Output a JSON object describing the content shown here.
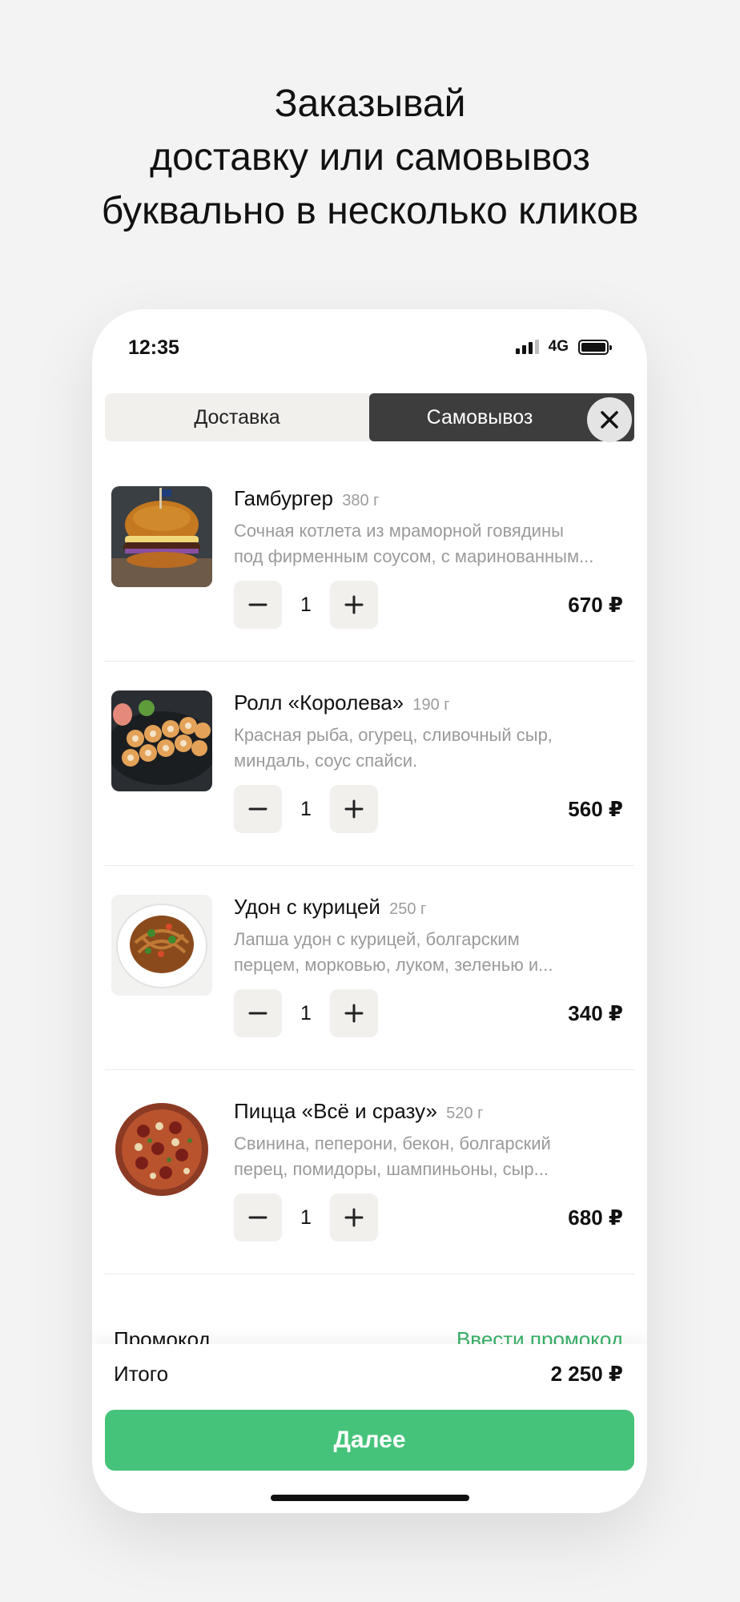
{
  "headline": {
    "line1": "Заказывай",
    "line2": "доставку или самовывоз",
    "line3": "буквально в несколько кликов"
  },
  "status_bar": {
    "time": "12:35",
    "network": "4G"
  },
  "tabs": {
    "delivery": "Доставка",
    "pickup": "Самовывоз",
    "active": "pickup"
  },
  "items": [
    {
      "title": "Гамбургер",
      "weight": "380 г",
      "desc_line1": "Сочная котлета из мраморной говядины",
      "desc_line2": "под фирменным соусом, с маринованным...",
      "qty": "1",
      "price": "670 ₽",
      "image_icon": "burger-photo"
    },
    {
      "title": "Ролл «Королева»",
      "weight": "190 г",
      "desc_line1": "Красная рыба, огурец, сливочный сыр,",
      "desc_line2": "миндаль, соус спайси.",
      "qty": "1",
      "price": "560 ₽",
      "image_icon": "sushi-roll-photo"
    },
    {
      "title": "Удон с курицей",
      "weight": "250 г",
      "desc_line1": "Лапша удон с курицей, болгарским",
      "desc_line2": "перцем, морковью, луком, зеленью и...",
      "qty": "1",
      "price": "340 ₽",
      "image_icon": "udon-bowl-photo"
    },
    {
      "title": "Пицца «Всё и сразу»",
      "weight": "520 г",
      "desc_line1": "Свинина, пеперони, бекон, болгарский",
      "desc_line2": "перец, помидоры, шампиньоны, сыр...",
      "qty": "1",
      "price": "680 ₽",
      "image_icon": "pizza-photo"
    }
  ],
  "promo": {
    "label": "Промокод",
    "link": "Ввести промокод"
  },
  "total": {
    "label": "Итого",
    "value": "2 250 ₽"
  },
  "next_button": "Далее",
  "colors": {
    "accent": "#46c37a",
    "promo_link": "#38b167",
    "active_tab": "#3d3d3d"
  }
}
